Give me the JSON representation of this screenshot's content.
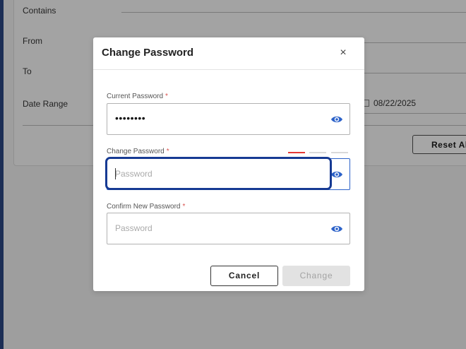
{
  "background": {
    "labels": {
      "contains": "Contains",
      "from": "From",
      "to": "To",
      "date_range": "Date Range"
    },
    "date_end": "08/22/2025",
    "reset_button": "Reset Al"
  },
  "modal": {
    "title": "Change Password",
    "close_icon": "×",
    "current_password": {
      "label": "Current Password",
      "required_mark": "*",
      "value": "••••••••"
    },
    "change_password": {
      "label": "Change Password",
      "required_mark": "*",
      "placeholder": "Password",
      "strength_colors": [
        "#e53935",
        "#d9d9d9",
        "#d9d9d9"
      ]
    },
    "confirm_password": {
      "label": "Confirm New Password",
      "required_mark": "*",
      "placeholder": "Password"
    },
    "cancel_label": "Cancel",
    "change_label": "Change",
    "eye_icon_color": "#2c62c9"
  }
}
